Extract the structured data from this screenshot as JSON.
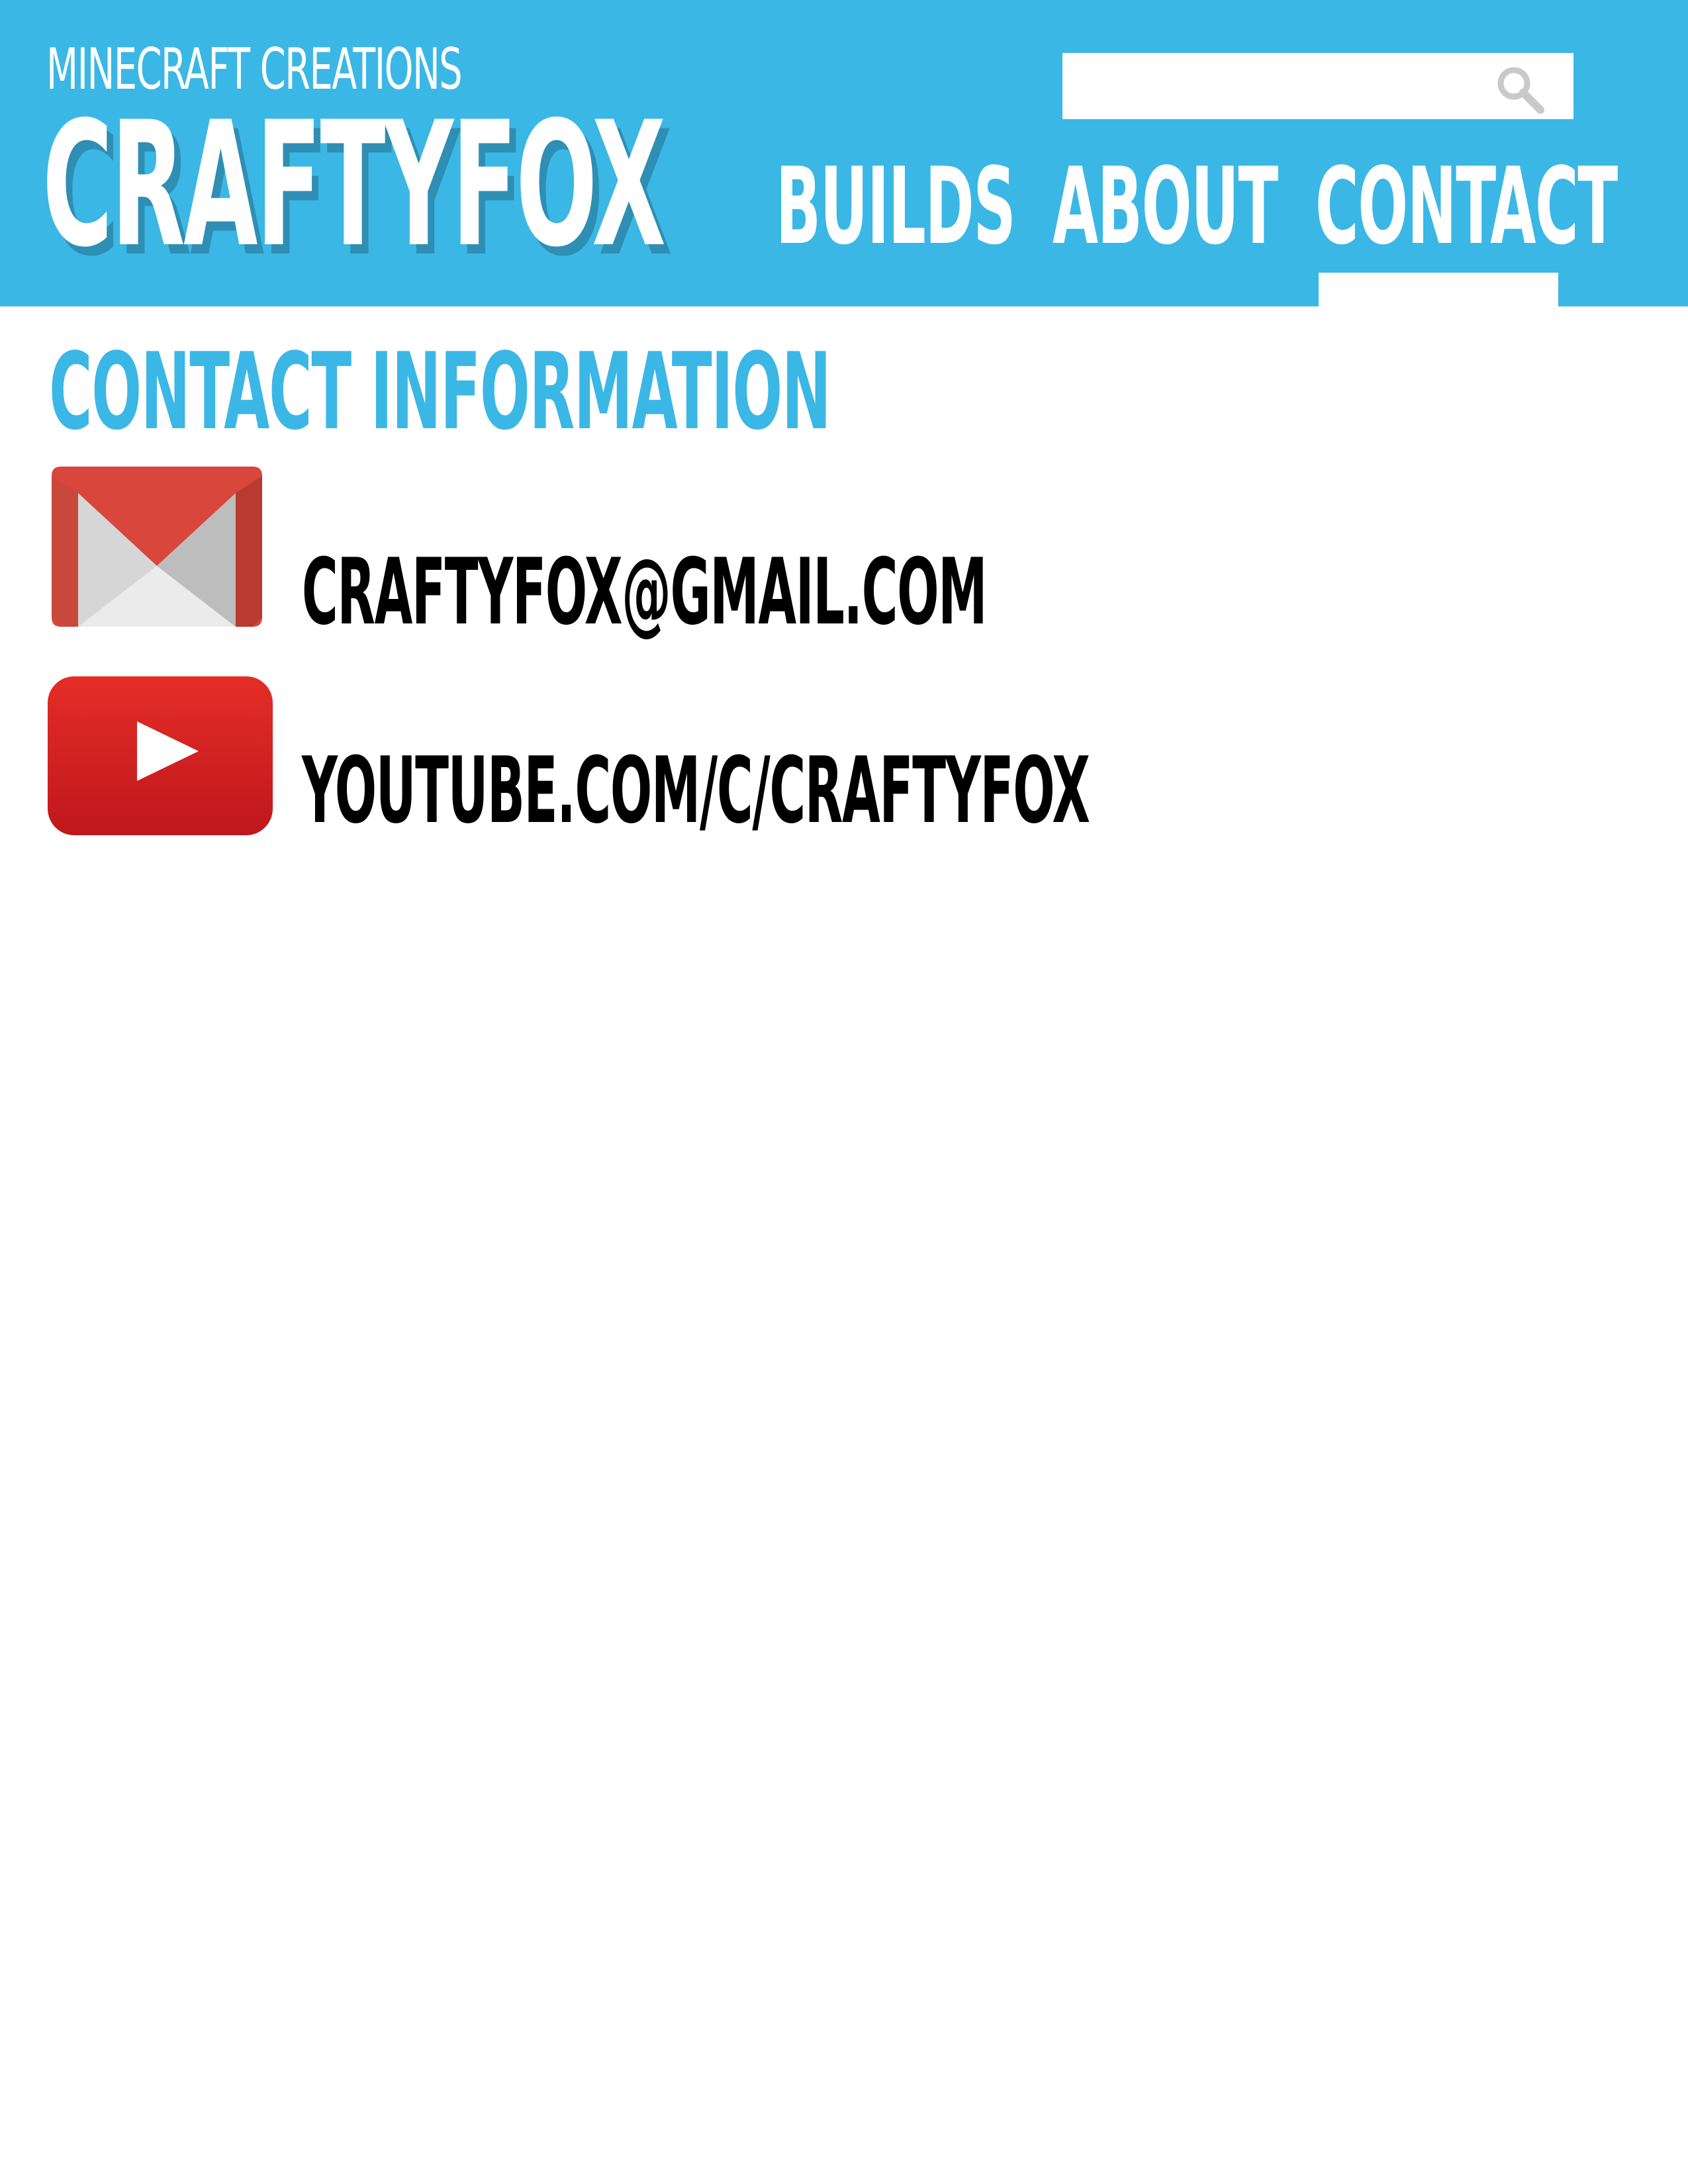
{
  "header": {
    "subtitle": "MINECRAFT CREATIONS",
    "logo": "CRAFTYFOX",
    "search": {
      "value": "",
      "icon": "search-icon"
    },
    "nav": [
      {
        "label": "BUILDS",
        "active": false
      },
      {
        "label": "ABOUT",
        "active": false
      },
      {
        "label": "CONTACT",
        "active": true
      }
    ]
  },
  "main": {
    "title": "CONTACT INFORMATION",
    "contacts": [
      {
        "icon": "gmail-icon",
        "text": "CRAFTYFOX@GMAIL.COM"
      },
      {
        "icon": "youtube-icon",
        "text": "YOUTUBE.COM/C/CRAFTYFOX"
      }
    ]
  },
  "colors": {
    "header_bg": "#3bb7e6",
    "accent": "#3bb7e6",
    "logo_shadow": "#2f8eb3",
    "text": "#000000"
  }
}
